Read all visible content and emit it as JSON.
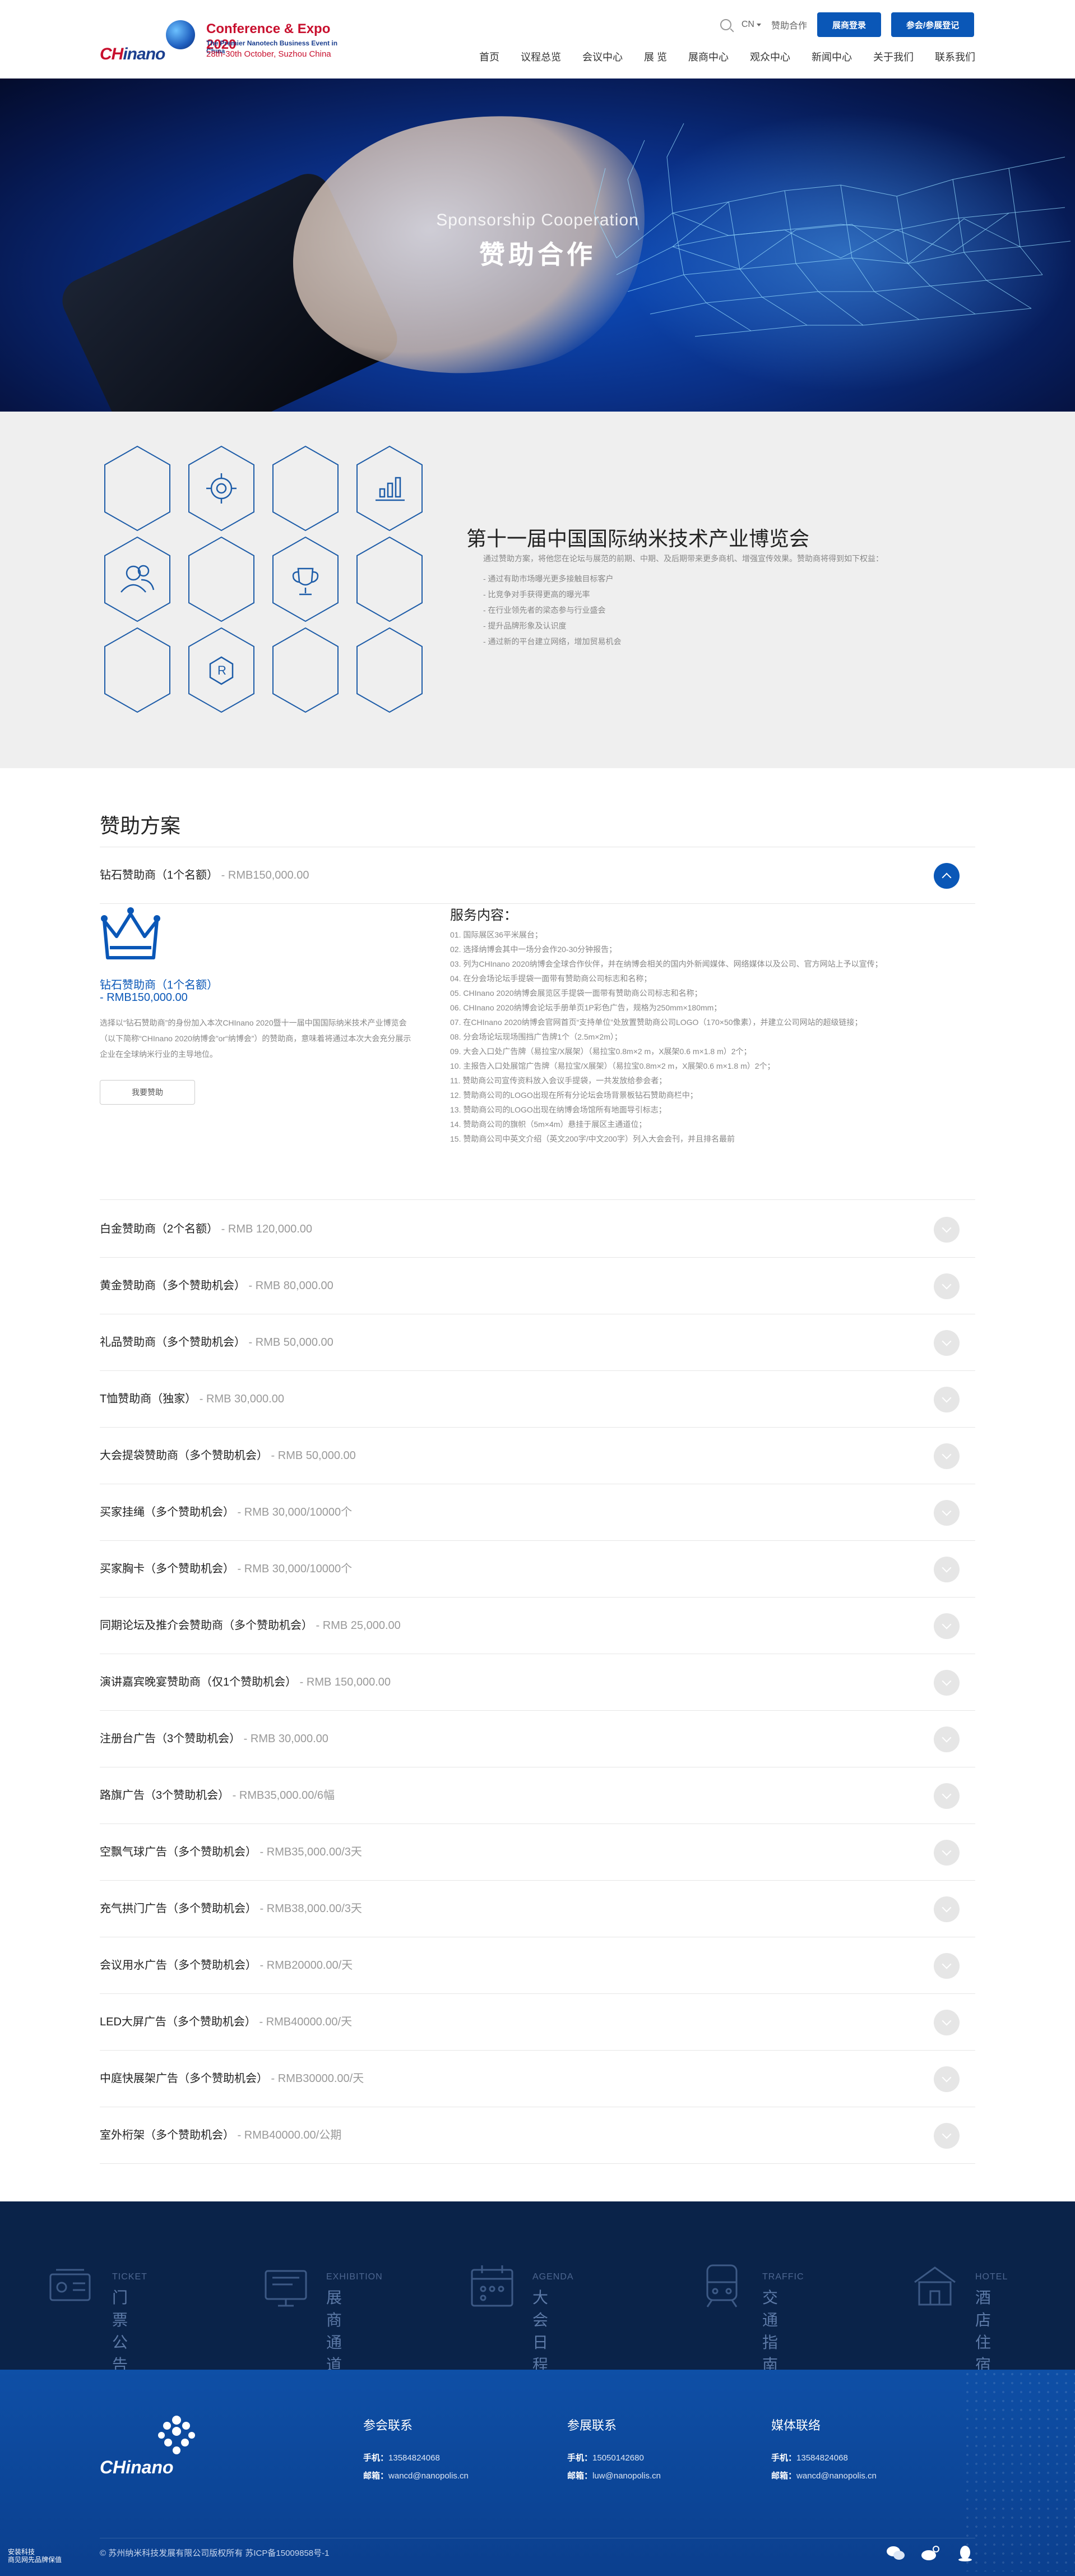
{
  "header": {
    "logo_text_ch": "CH",
    "logo_text_rest": "inano",
    "logo_title": "Conference & Expo 2020",
    "logo_sub1": "The Premier Nanotech Business Event in China",
    "logo_sub2": "28th-30th October, Suzhou China",
    "lang": "CN",
    "sponsor_link": "赞助合作",
    "login_button": "展商登录",
    "register_button": "参会/参展登记",
    "nav": [
      "首页",
      "议程总览",
      "会议中心",
      "展 览",
      "展商中心",
      "观众中心",
      "新闻中心",
      "关于我们",
      "联系我们"
    ]
  },
  "hero": {
    "title_en": "Sponsorship Cooperation",
    "title_cn": "赞助合作"
  },
  "intro": {
    "title": "第十一届中国国际纳米技术产业博览会",
    "desc": "通过赞助方案，将他您在论坛与展范的前期、中期、及后期带来更多商机、增强宣传效果。赞助商将得到如下权益：",
    "benefits": [
      "- 通过有助市场曝光更多接触目标客户",
      "- 比竞争对手获得更高的曝光率",
      "- 在行业领先者的梁态参与行业盛会",
      "- 提升品牌形象及认识度",
      "- 通过新的平台建立网络，增加贸易机会"
    ]
  },
  "plan": {
    "title": "赞助方案",
    "expanded": {
      "name": "钻石赞助商（1个名额）",
      "price_sep": " - ",
      "price": "RMB150,000.00",
      "detail_name": "钻石赞助商（1个名额）",
      "detail_price": "- RMB150,000.00",
      "description": "选择以“钻石赞助商”的身份加入本次CHInano 2020暨十一届中国国际纳米技术产业博览会（以下简称“CHInano 2020纳博会”or“纳博会”）的赞助商，意味着将通过本次大会充分展示企业在全球纳米行业的主导地位。",
      "apply_button": "我要赞助",
      "services_title": "服务内容：",
      "services": [
        "01. 国际展区36平米展台；",
        "02. 选择纳博会其中一场分会作20-30分钟报告；",
        "03. 列为CHInano 2020纳博会全球合作伙伴，并在纳博会相关的国内外新闻媒体、网络媒体以及公司、官方网站上予以宣传；",
        "04. 在分会场论坛手提袋一面带有赞助商公司标志和名称；",
        "05. CHInano 2020纳博会展览区手提袋一面带有赞助商公司标志和名称；",
        "06. CHInano 2020纳博会论坛手册单页1P彩色广告，规格为250mm×180mm；",
        "07. 在CHInano 2020纳博会官网首页“支持单位”处放置赞助商公司LOGO（170×50像素），并建立公司网站的超级链接；",
        "08. 分会场论坛现场围挡广告牌1个（2.5m×2m）；",
        "09. 大会入口处广告牌（易拉宝/X展架）（易拉宝0.8m×2 m，X展架0.6 m×1.8 m）2个；",
        "10. 主报告入口处展馆广告牌（易拉宝/X展架）（易拉宝0.8m×2 m，X展架0.6 m×1.8 m）2个；",
        "11. 赞助商公司宣传资料放入会议手提袋，一共发放给参会者；",
        "12. 赞助商公司的LOGO出现在所有分论坛会场背景板钻石赞助商栏中；",
        "13. 赞助商公司的LOGO出现在纳博会场馆所有地面导引标志；",
        "14. 赞助商公司的旗帜（5m×4m）悬挂于展区主通道位；",
        "15. 赞助商公司中英文介绍（英文200字/中文200字）列入大会会刊，并且排名最前"
      ]
    },
    "rows": [
      {
        "name": "白金赞助商（2个名额）",
        "price": "RMB 120,000.00"
      },
      {
        "name": "黄金赞助商（多个赞助机会）",
        "price": "RMB 80,000.00"
      },
      {
        "name": "礼品赞助商（多个赞助机会）",
        "price": "RMB 50,000.00"
      },
      {
        "name": "T恤赞助商（独家）",
        "price": "RMB 30,000.00"
      },
      {
        "name": "大会提袋赞助商（多个赞助机会）",
        "price": "RMB 50,000.00"
      },
      {
        "name": "买家挂绳（多个赞助机会）",
        "price": "RMB 30,000/10000个"
      },
      {
        "name": "买家胸卡（多个赞助机会）",
        "price": "RMB 30,000/10000个"
      },
      {
        "name": "同期论坛及推介会赞助商（多个赞助机会）",
        "price": "RMB 25,000.00"
      },
      {
        "name": "演讲嘉宾晚宴赞助商（仅1个赞助机会）",
        "price": "RMB 150,000.00"
      },
      {
        "name": "注册台广告（3个赞助机会）",
        "price": "RMB 30,000.00"
      },
      {
        "name": "路旗广告（3个赞助机会）",
        "price": "RMB35,000.00/6幅"
      },
      {
        "name": "空飘气球广告（多个赞助机会）",
        "price": "RMB35,000.00/3天"
      },
      {
        "name": "充气拱门广告（多个赞助机会）",
        "price": "RMB38,000.00/3天"
      },
      {
        "name": "会议用水广告（多个赞助机会）",
        "price": "RMB20000.00/天"
      },
      {
        "name": "LED大屏广告（多个赞助机会）",
        "price": "RMB40000.00/天"
      },
      {
        "name": "中庭快展架广告（多个赞助机会）",
        "price": "RMB30000.00/天"
      },
      {
        "name": "室外桁架（多个赞助机会）",
        "price": "RMB40000.00/公期"
      }
    ]
  },
  "categories": [
    {
      "en": "TICKET",
      "cn": "门票公告",
      "icon": "ticket-icon"
    },
    {
      "en": "EXHIBITION",
      "cn": "展商通道",
      "icon": "exhibition-icon"
    },
    {
      "en": "AGENDA",
      "cn": "大会日程安排",
      "icon": "agenda-icon"
    },
    {
      "en": "TRAFFIC",
      "cn": "交通指南",
      "icon": "train-icon"
    },
    {
      "en": "HOTEL",
      "cn": "酒店住宿",
      "icon": "hotel-icon"
    }
  ],
  "footer": {
    "logo_text": "CHinano",
    "contacts": [
      {
        "title": "参会联系",
        "phone_label": "手机：",
        "phone": "13584824068",
        "email_label": "邮箱：",
        "email": "wancd@nanopolis.cn"
      },
      {
        "title": "参展联系",
        "phone_label": "手机：",
        "phone": "15050142680",
        "email_label": "邮箱：",
        "email": "luw@nanopolis.cn"
      },
      {
        "title": "媒体联络",
        "phone_label": "手机：",
        "phone": "13584824068",
        "email_label": "邮箱：",
        "email": "wancd@nanopolis.cn"
      }
    ],
    "copyright": "© 苏州纳米科技发展有限公司版权所有 苏ICP备15009858号-1",
    "badge_line1": "安装科技",
    "badge_line2": "商见网先品牌保值"
  }
}
